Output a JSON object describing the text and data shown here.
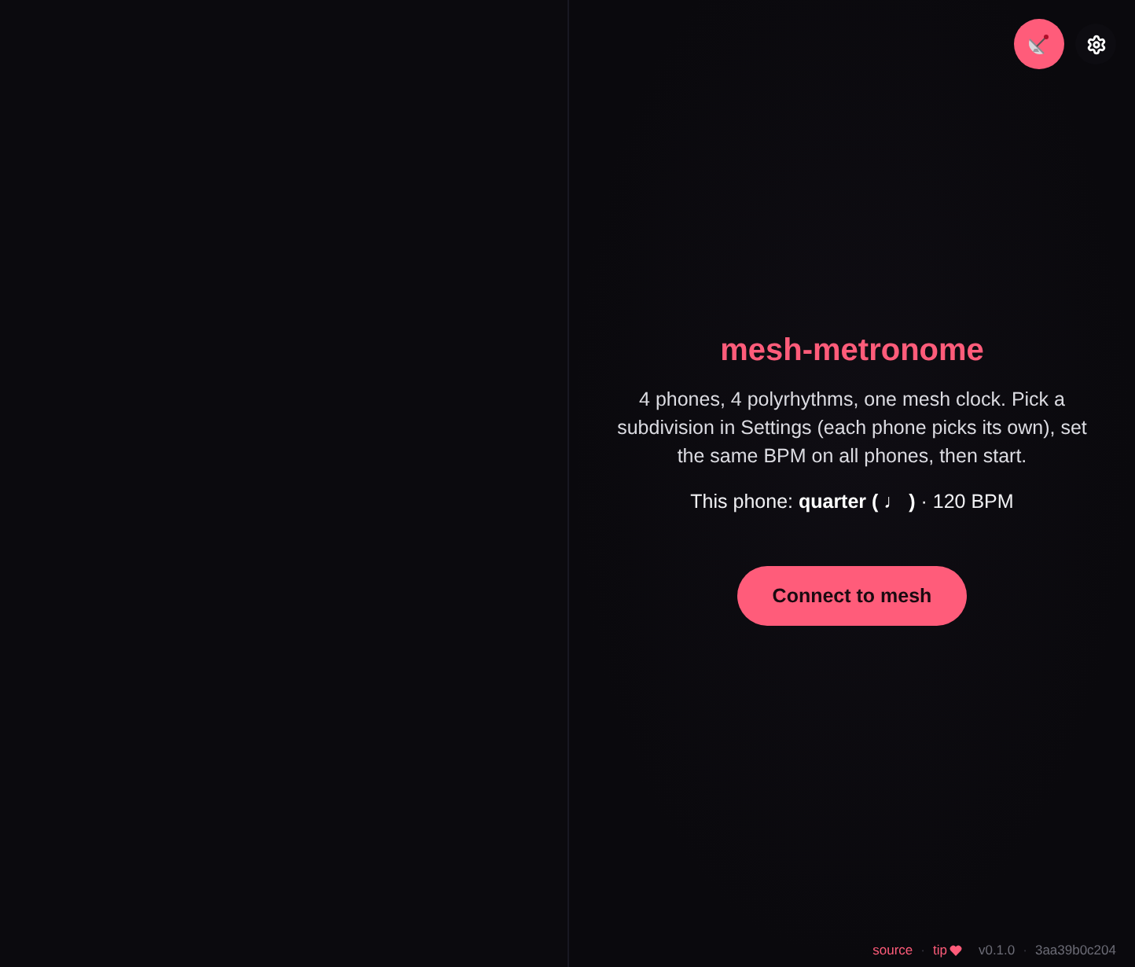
{
  "top_bar": {
    "buttons": [
      {
        "kind": "mesh"
      },
      {
        "kind": "settings"
      }
    ]
  },
  "title": "mesh-metronome",
  "description": "4 phones, 4 polyrhythms, one mesh clock. Pick a subdivision in Settings (each phone picks its own), set the same BPM on all phones, then start.",
  "phone_info": "This phone: **quarter ( ♩ )** · 120 BPM",
  "connect_button": {
    "label": "Connect to mesh"
  },
  "footer": {
    "items": [
      {
        "kind": "link",
        "text": "source"
      },
      {
        "kind": "separator",
        "text": "·"
      },
      {
        "kind": "sponsor",
        "text": "tip"
      },
      {
        "kind": "version",
        "text": "v0.1.0"
      },
      {
        "kind": "separator",
        "text": "·"
      },
      {
        "kind": "version",
        "text": "3aa39b0c204"
      }
    ]
  }
}
